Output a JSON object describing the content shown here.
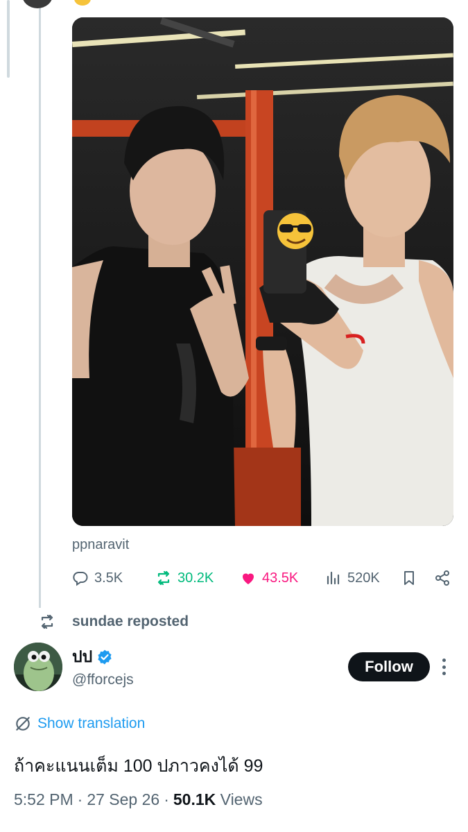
{
  "media": {
    "caption": "ppnaravit"
  },
  "actions": {
    "replies": "3.5K",
    "reposts": "30.2K",
    "likes": "43.5K",
    "views": "520K"
  },
  "repost_banner": {
    "text": "sundae reposted"
  },
  "author": {
    "display_name": "ปป",
    "handle": "@fforcejs",
    "follow_label": "Follow"
  },
  "translation_label": "Show translation",
  "post_text": "ถ้าคะแนนเต็ม 100 ปภาวคงได้ 99",
  "meta": {
    "time": "5:52 PM",
    "date": "27 Sep 26",
    "views_count": "50.1K",
    "views_label": "Views",
    "separator": "·"
  },
  "colors": {
    "accent": "#1d9bf0",
    "repost": "#00ba7c",
    "like": "#f91880",
    "secondary_text": "#536471",
    "primary_text": "#0f1419"
  }
}
